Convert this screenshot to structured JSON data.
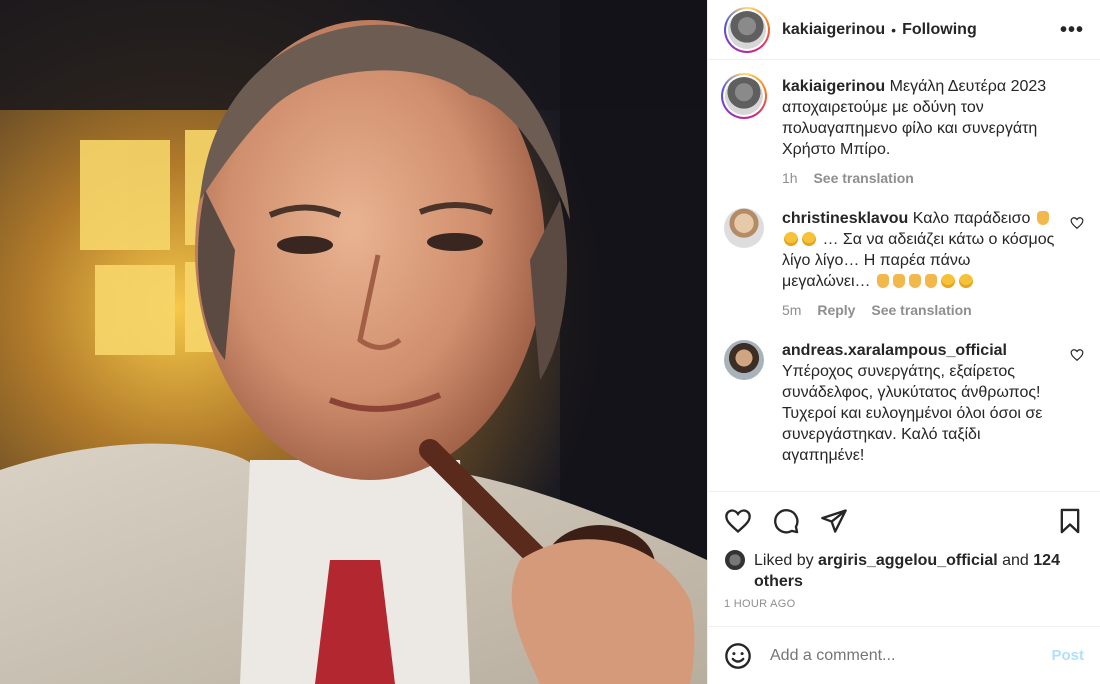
{
  "post": {
    "username": "kakiaigerinou",
    "separator": "•",
    "follow_status": "Following",
    "more_label": "•••"
  },
  "caption": {
    "username": "kakiaigerinou",
    "text": "Μεγάλη Δευτέρα 2023 αποχαιρετούμε με οδύνη τον πολυαγαπημενο φίλο και συνεργάτη Χρήστο Μπίρο.",
    "time": "1h",
    "see_translation": "See translation"
  },
  "comments": [
    {
      "username": "christinesklavou",
      "text_1": "Καλο παράδεισο",
      "text_2": "… Σα να αδειάζει κάτω ο κόσμος λίγο λίγο… Η παρέα πάνω μεγαλώνει…",
      "time": "5m",
      "reply": "Reply",
      "see_translation": "See translation"
    },
    {
      "username": "andreas.xaralampous_official",
      "text": "Υπέροχος συνεργάτης, εξαίρετος συνάδελφος, γλυκύτατος άνθρωπος! Τυχεροί και ευλογημένοι όλοι όσοι σε συνεργάστηκαν. Καλό ταξίδι αγαπημένε!"
    }
  ],
  "likes": {
    "prefix": "Liked by",
    "user": "argiris_aggelou_official",
    "and": "and",
    "count": "124 others"
  },
  "timestamp": "1 HOUR AGO",
  "add_comment": {
    "placeholder": "Add a comment...",
    "post_label": "Post"
  },
  "icons": {
    "like": "heart-icon",
    "comment": "comment-icon",
    "share": "share-icon",
    "save": "bookmark-icon",
    "emoji": "emoji-icon",
    "more": "more-icon"
  },
  "colors": {
    "link_disabled": "#b2dffc",
    "secondary_text": "#8e8e8e",
    "primary_text": "#262626"
  }
}
